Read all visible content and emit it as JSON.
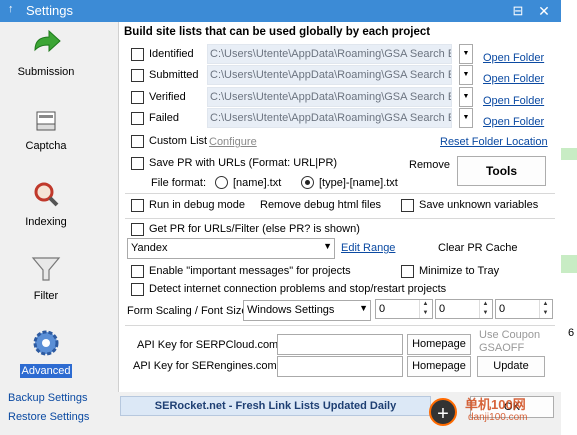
{
  "window": {
    "title": "Settings",
    "pin_icon": "pin-icon",
    "minimize": "⊟",
    "close": "✕"
  },
  "sidebar": {
    "items": [
      {
        "label": "Submission",
        "icon": "green-arrow-icon"
      },
      {
        "label": "Captcha",
        "icon": "captcha-icon"
      },
      {
        "label": "Indexing",
        "icon": "magnifier-icon"
      },
      {
        "label": "Filter",
        "icon": "funnel-icon"
      },
      {
        "label": "Advanced",
        "icon": "gear-icon",
        "active": true
      }
    ],
    "backup": "Backup Settings",
    "restore": "Restore Settings"
  },
  "main": {
    "header": "Build site lists that can be used globally by each project",
    "lists": [
      {
        "label": "Identified",
        "path": "C:\\Users\\Utente\\AppData\\Roaming\\GSA Search En",
        "open": "Open Folder"
      },
      {
        "label": "Submitted",
        "path": "C:\\Users\\Utente\\AppData\\Roaming\\GSA Search En",
        "open": "Open Folder"
      },
      {
        "label": "Verified",
        "path": "C:\\Users\\Utente\\AppData\\Roaming\\GSA Search En",
        "open": "Open Folder"
      },
      {
        "label": "Failed",
        "path": "C:\\Users\\Utente\\AppData\\Roaming\\GSA Search En",
        "open": "Open Folder"
      }
    ],
    "custom_list": "Custom List",
    "configure": "Configure",
    "reset_folder": "Reset Folder Location",
    "save_pr": "Save PR with URLs (Format: URL|PR)",
    "remove": "Remove",
    "tools": "Tools",
    "file_format": "File format:",
    "format_name": "[name].txt",
    "format_type": "[type]-[name].txt",
    "debug_mode": "Run in debug mode",
    "remove_debug": "Remove debug html files",
    "save_unknown": "Save unknown variables",
    "get_pr": "Get PR for URLs/Filter  (else PR? is shown)",
    "pr_source": "Yandex",
    "edit_range": "Edit Range",
    "clear_pr": "Clear PR Cache",
    "important_msgs": "Enable \"important messages\" for projects",
    "minimize_tray": "Minimize to Tray",
    "detect_internet": "Detect internet connection problems and stop/restart projects",
    "font_scaling": "Form Scaling / Font Size",
    "font_setting": "Windows Settings",
    "spin_values": [
      "0",
      "0",
      "0"
    ],
    "serpcloud_label": "API Key for SERPCloud.com",
    "serengines_label": "API Key for SERengines.com",
    "homepage": "Homepage",
    "use_coupon": "Use Coupon",
    "coupon_code": "GSAOFF",
    "update": "Update"
  },
  "footer": {
    "banner": "SERocket.net - Fresh Link Lists Updated Daily",
    "ok": "OK"
  },
  "watermark": {
    "text": "单机100网",
    "url": "danji100.com"
  },
  "background_number": "6",
  "colors": {
    "titlebar": "#3c8bd6",
    "link": "#0b4aa2",
    "active": "#2d6bd1"
  }
}
